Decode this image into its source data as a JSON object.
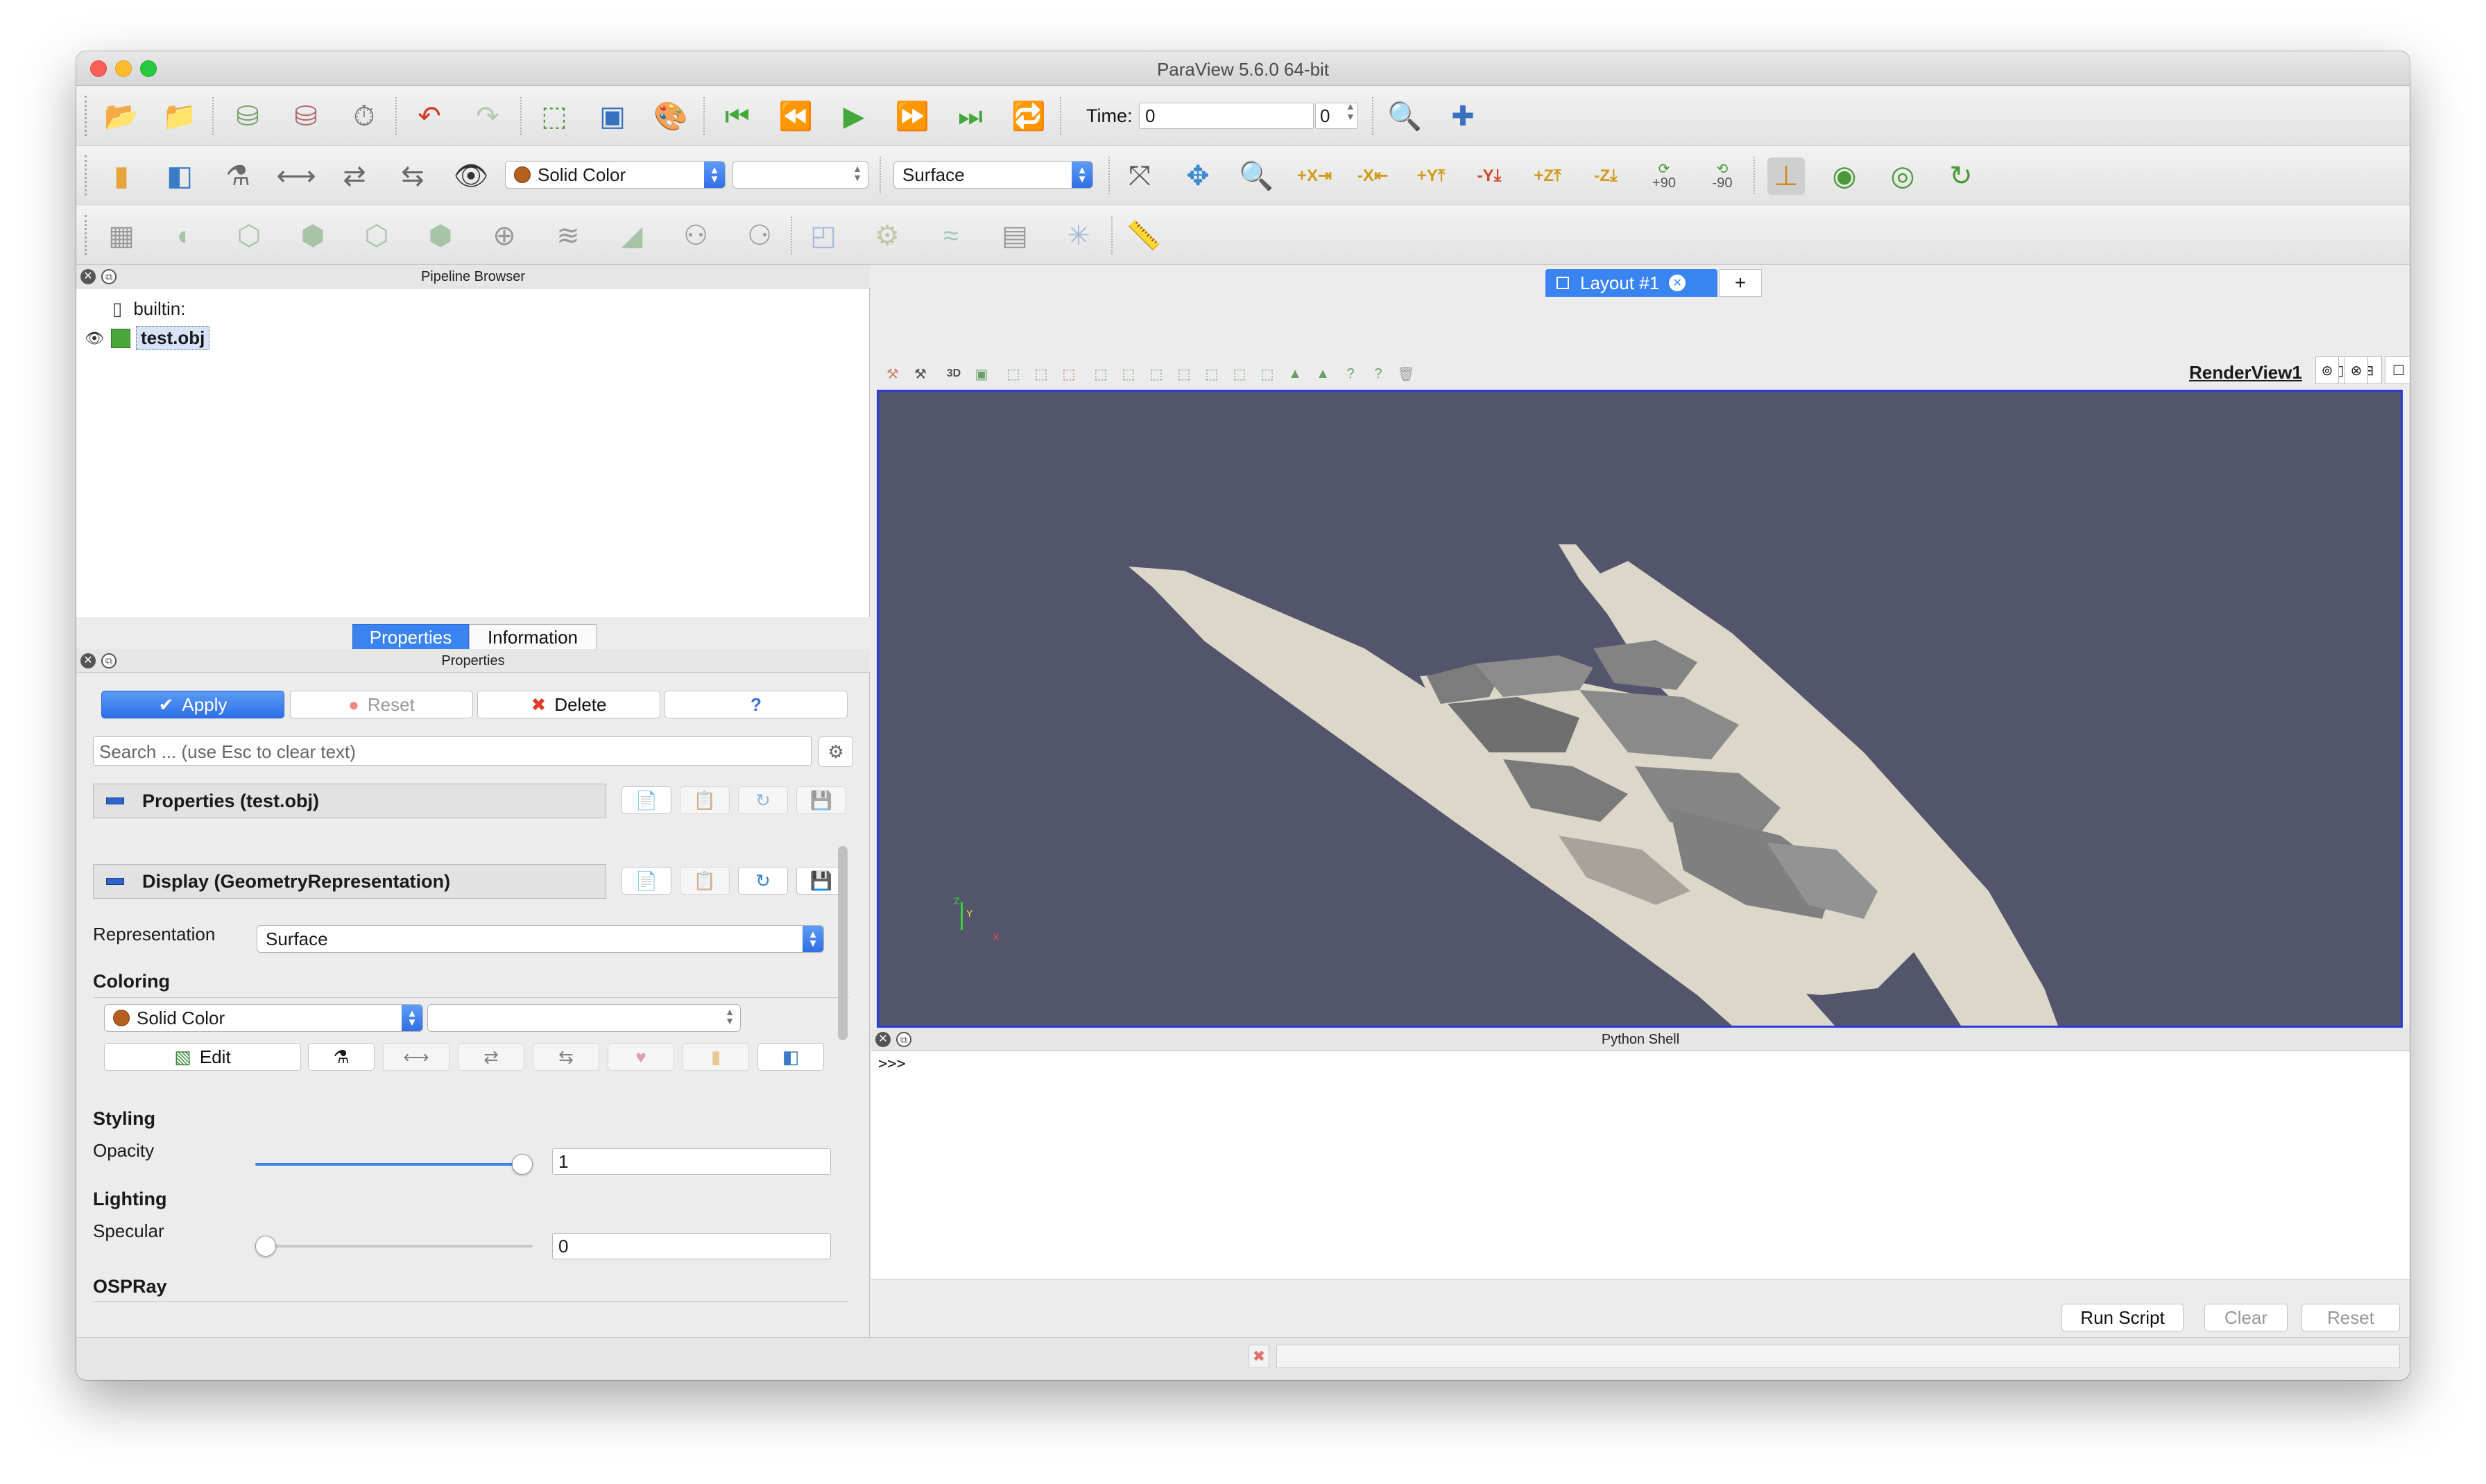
{
  "window": {
    "title": "ParaView 5.6.0 64-bit"
  },
  "toolbar1": {
    "time_label": "Time:",
    "time_value": "0",
    "time_index": "0",
    "icons": [
      "open-icon",
      "recent-open-icon",
      "connect-icon",
      "disconnect-icon",
      "timer-icon",
      "undo-icon",
      "redo-icon",
      "reset-camera-icon",
      "save-screenshot-icon",
      "color-palette-icon",
      "first-frame-icon",
      "previous-frame-icon",
      "play-icon",
      "next-frame-icon",
      "last-frame-icon",
      "loop-icon",
      "find-data-icon",
      "add-custom-filter-icon"
    ]
  },
  "toolbar2": {
    "coloring_value": "Solid Color",
    "component_value": "",
    "representation_value": "Surface",
    "camera_labels": {
      "plus_x": "+X",
      "minus_x": "-X",
      "plus_y": "+Y",
      "minus_y": "-Y",
      "plus_z": "+Z",
      "minus_z": "-Z",
      "rot_plus": "+90",
      "rot_minus": "-90"
    }
  },
  "pipeline": {
    "title": "Pipeline Browser",
    "items": [
      {
        "label": "builtin:"
      },
      {
        "label": "test.obj"
      }
    ]
  },
  "tabs": {
    "properties": "Properties",
    "information": "Information"
  },
  "properties": {
    "title": "Properties",
    "apply": "Apply",
    "reset": "Reset",
    "delete": "Delete",
    "help": "?",
    "search_placeholder": "Search ... (use Esc to clear text)",
    "section1": "Properties (test.obj)",
    "section2": "Display (GeometryRepresentation)",
    "representation_label": "Representation",
    "representation_value": "Surface",
    "coloring_label": "Coloring",
    "coloring_value": "Solid Color",
    "edit": "Edit",
    "styling_label": "Styling",
    "opacity_label": "Opacity",
    "opacity_value": "1",
    "opacity_fraction": 1.0,
    "lighting_label": "Lighting",
    "specular_label": "Specular",
    "specular_value": "0",
    "specular_fraction": 0.0,
    "ospray_label": "OSPRay"
  },
  "layout": {
    "tab_label": "Layout #1",
    "add_tab": "+",
    "render_view": "RenderView1",
    "render_toolbar_3d": "3D",
    "background_color": "#52556b",
    "model_color": "#ddd7c9",
    "axes": {
      "z": "Z",
      "y": "Y",
      "x": "X"
    }
  },
  "python": {
    "title": "Python Shell",
    "prompt": ">>>",
    "run_script": "Run Script",
    "clear": "Clear",
    "reset": "Reset"
  }
}
